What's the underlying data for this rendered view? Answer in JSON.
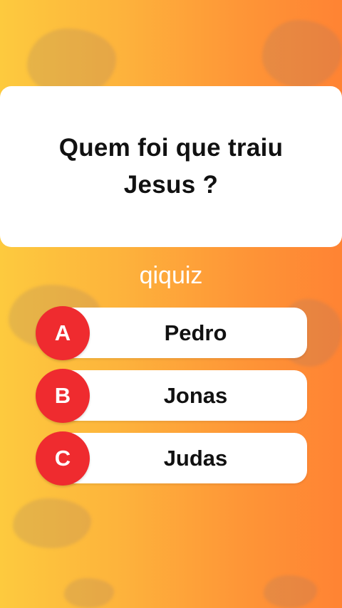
{
  "question": {
    "line1": "Quem foi que traiu",
    "line2": "Jesus ?"
  },
  "brand": "qiquiz",
  "answers": [
    {
      "letter": "A",
      "text": "Pedro"
    },
    {
      "letter": "B",
      "text": "Jonas"
    },
    {
      "letter": "C",
      "text": "Judas"
    }
  ],
  "colors": {
    "background_left": "#fdca3e",
    "background_right": "#ff8333",
    "letter_badge": "#ef2b2f",
    "card": "#ffffff"
  }
}
